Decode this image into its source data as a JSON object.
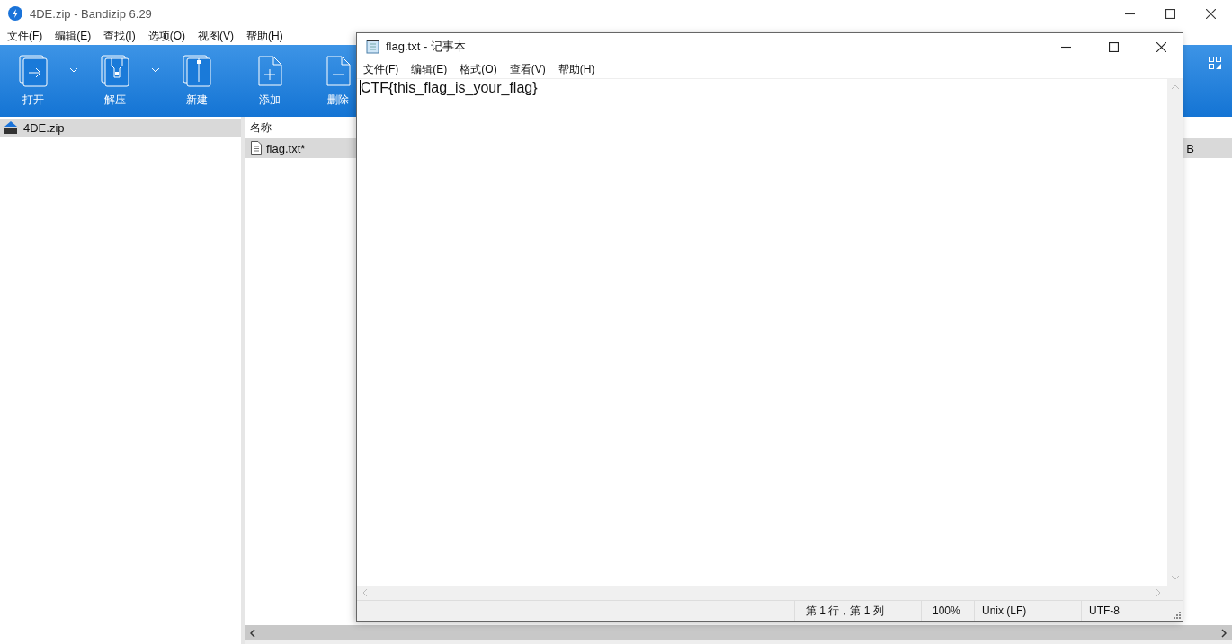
{
  "bandizip": {
    "title": "4DE.zip - Bandizip 6.29",
    "menu": [
      "文件(F)",
      "编辑(E)",
      "查找(I)",
      "选项(O)",
      "视图(V)",
      "帮助(H)"
    ],
    "toolbar": [
      {
        "label": "打开",
        "kind": "open",
        "dropdown": true
      },
      {
        "label": "解压",
        "kind": "extract",
        "dropdown": true
      },
      {
        "label": "新建",
        "kind": "new",
        "dropdown": false
      },
      {
        "label": "添加",
        "kind": "add",
        "dropdown": false
      },
      {
        "label": "删除",
        "kind": "delete",
        "dropdown": false
      }
    ],
    "tree": [
      {
        "label": "4DE.zip",
        "selected": true
      }
    ],
    "list": {
      "columns": [
        "名称"
      ],
      "rows": [
        {
          "name": "flag.txt*",
          "column_2": "B",
          "selected": true
        }
      ]
    }
  },
  "notepad": {
    "title": "flag.txt - 记事本",
    "menu": [
      "文件(F)",
      "编辑(E)",
      "格式(O)",
      "查看(V)",
      "帮助(H)"
    ],
    "text": "CTF{this_flag_is_your_flag}",
    "status": [
      "第 1 行，第 1 列",
      "100%",
      "Unix (LF)",
      "UTF-8"
    ]
  }
}
